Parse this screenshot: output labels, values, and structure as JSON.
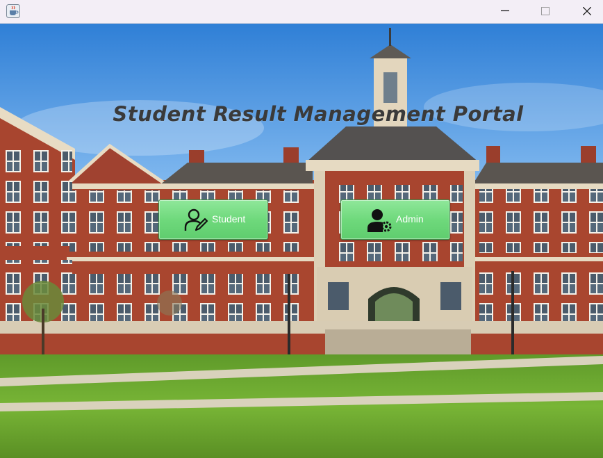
{
  "window": {
    "title": "",
    "icon": "java-cup-icon",
    "controls": [
      "minimize-icon",
      "maximize-icon",
      "close-icon"
    ]
  },
  "portal": {
    "title": "Student Result Management Portal",
    "buttons": {
      "student": {
        "label": "Student",
        "icon": "user-edit-icon"
      },
      "admin": {
        "label": "Admin",
        "icon": "user-gear-icon"
      }
    }
  },
  "colors": {
    "button_green": "#6fd97c",
    "title_text": "#3a3a3a",
    "button_text": "#ffffff"
  }
}
